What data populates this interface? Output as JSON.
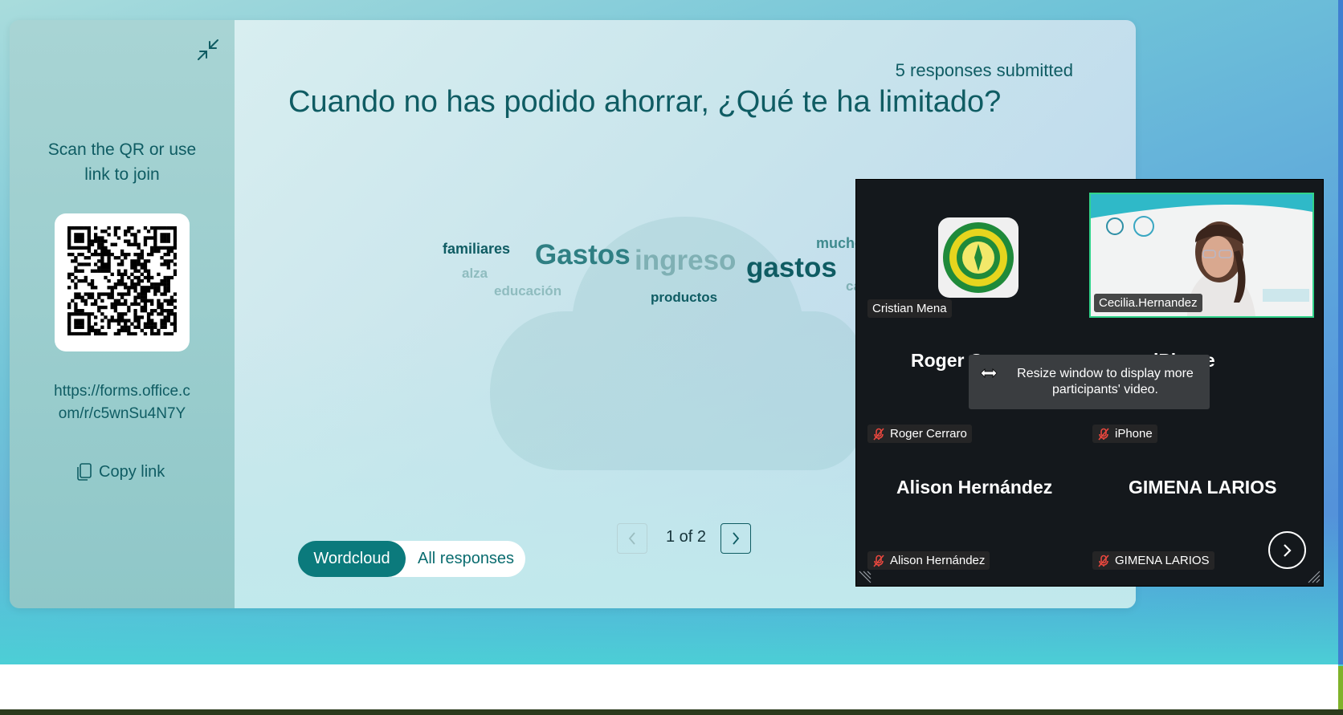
{
  "side": {
    "scan_text": "Scan the QR or use link to join",
    "link": "https://forms.office.com/r/c5wnSu4N7Y",
    "copy_label": "Copy link"
  },
  "main": {
    "responses_label": "5 responses submitted",
    "question": "Cuando no has podido ahorrar, ¿Qué te ha limitado?",
    "words": [
      {
        "text": "familiares",
        "color": "#0f5c63"
      },
      {
        "text": "Gastos",
        "color": "#2f7f83"
      },
      {
        "text": "ingreso",
        "color": "#7fb0b4"
      },
      {
        "text": "gastos",
        "color": "#0f5c63"
      },
      {
        "text": "mucho",
        "color": "#3f8a8e"
      },
      {
        "text": "alza",
        "color": "#8fbcbf"
      },
      {
        "text": "educación",
        "color": "#8fbcbf"
      },
      {
        "text": "productos",
        "color": "#0f5c63"
      },
      {
        "text": "ca",
        "color": "#7fb0b4"
      }
    ],
    "toggle": {
      "active": "Wordcloud",
      "other": "All responses"
    },
    "pagination": "1 of 2"
  },
  "meeting": {
    "tiles": [
      {
        "name": "Cristian Mena"
      },
      {
        "name": "Cecilia.Hernandez"
      },
      {
        "name": "Roger Cerraro",
        "big": "Roger Cerraro"
      },
      {
        "name": "iPhone",
        "big": "iPhone"
      },
      {
        "name": "Alison Hernández",
        "big": "Alison Hernández"
      },
      {
        "name": "GIMENA LARIOS",
        "big": "GIMENA LARIOS"
      }
    ],
    "tooltip": "Resize window to display more participants' video."
  },
  "colors": {
    "accent": "#0b7a7c",
    "text": "#0f5c63",
    "active_speaker": "#31d38a",
    "mic_off": "#e8473e"
  }
}
